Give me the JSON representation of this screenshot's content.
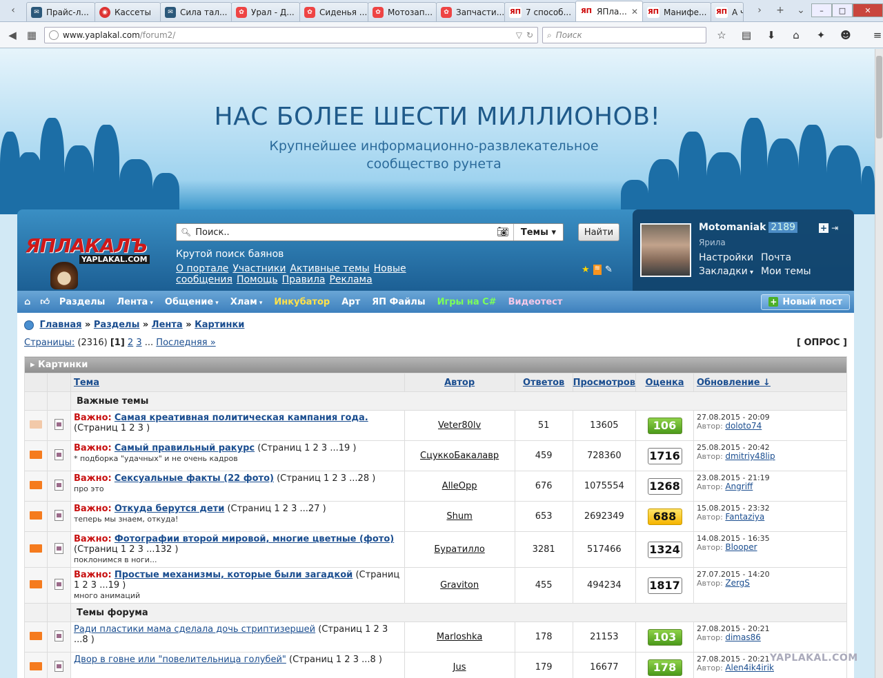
{
  "browser": {
    "tabs": [
      {
        "label": "Прайс-л...",
        "icon": "vk"
      },
      {
        "label": "Кассеты",
        "icon": "mp"
      },
      {
        "label": "Сила тал...",
        "icon": "vk"
      },
      {
        "label": "Урал - Д...",
        "icon": "mt"
      },
      {
        "label": "Сиденья ...",
        "icon": "mt"
      },
      {
        "label": "Мотозап...",
        "icon": "mt"
      },
      {
        "label": "Запчасти...",
        "icon": "mt"
      },
      {
        "label": "7 способ...",
        "icon": "yp"
      },
      {
        "label": "ЯПла...",
        "icon": "yp",
        "active": true
      },
      {
        "label": "Манифе...",
        "icon": "yp"
      },
      {
        "label": "А ч",
        "icon": "yp"
      }
    ],
    "url_domain": "www.yaplakal.com",
    "url_path": "/forum2/",
    "search_placeholder": "Поиск"
  },
  "banner": {
    "title": "НАС БОЛЕЕ ШЕСТИ МИЛЛИОНОВ!",
    "subtitle_line1": "Крупнейшее информационно-развлекательное",
    "subtitle_line2": "сообщество рунета"
  },
  "header": {
    "logo_text": "ЯПЛАКАЛЪ",
    "logo_sub": "YAPLAKAL.COM",
    "search_value": "Поиск..",
    "search_scope": "Темы",
    "find_button": "Найти",
    "tagline": "Крутой поиск баянов",
    "links": [
      "О портале",
      "Участники",
      "Активные темы",
      "Новые сообщения",
      "Помощь",
      "Правила",
      "Реклама"
    ]
  },
  "user": {
    "name": "Motomaniak",
    "count": "2189",
    "rank": "Ярила",
    "settings": "Настройки",
    "mail": "Почта",
    "bookmarks": "Закладки",
    "my_topics": "Мои темы"
  },
  "menu": {
    "items": [
      "Разделы",
      "Лента",
      "Общение",
      "Хлам",
      "Инкубатор",
      "Арт",
      "ЯП Файлы",
      "Игры на C#",
      "Видеотест"
    ],
    "new_post": "Новый пост"
  },
  "breadcrumb": [
    "Главная",
    "Разделы",
    "Лента",
    "Картинки"
  ],
  "pagination": {
    "label": "Страницы:",
    "total": "(2316)",
    "current": "[1]",
    "p2": "2",
    "p3": "3",
    "dots": "...",
    "last": "Последняя »",
    "poll": "[ ОПРОС ]"
  },
  "table": {
    "caption": "Картинки",
    "columns": [
      "Тема",
      "Автор",
      "Ответов",
      "Просмотров",
      "Оценка",
      "Обновление ↓"
    ],
    "important_header": "Важные темы",
    "forum_header": "Темы форума",
    "important_label": "Важно:",
    "rows": [
      {
        "title": "Самая креативная политическая кампания года.",
        "pages": "(Страниц 1 2 3 )",
        "desc": "",
        "author": "Veter80lv",
        "replies": "51",
        "views": "13605",
        "score": "106",
        "score_style": "g",
        "date": "27.08.2015 - 20:09",
        "last": "doloto74",
        "env": "pale"
      },
      {
        "title": "Самый правильный ракурс",
        "pages": "(Страниц 1 2 3 ...19 )",
        "desc": "* подборка \"удачных\" и не очень кадров",
        "author": "СцуккоБакалавр",
        "replies": "459",
        "views": "728360",
        "score": "1716",
        "score_style": "w",
        "date": "25.08.2015 - 20:42",
        "last": "dmitriy48lip",
        "env": "o"
      },
      {
        "title": "Сексуальные факты (22 фото)",
        "pages": "(Страниц 1 2 3 ...28 )",
        "desc": "про это",
        "author": "AlleOpp",
        "replies": "676",
        "views": "1075554",
        "score": "1268",
        "score_style": "w",
        "date": "23.08.2015 - 21:19",
        "last": "Angriff",
        "env": "o"
      },
      {
        "title": "Откуда берутся дети",
        "pages": "(Страниц 1 2 3 ...27 )",
        "desc": "теперь мы знаем, откуда!",
        "author": "Shum",
        "replies": "653",
        "views": "2692349",
        "score": "688",
        "score_style": "y",
        "date": "15.08.2015 - 23:32",
        "last": "Fantaziya",
        "env": "o"
      },
      {
        "title": "Фотографии второй мировой, многие цветные (фото)",
        "pages": "(Страниц 1 2 3 ...132 )",
        "desc": "поклонимся в ноги...",
        "author": "Буратилло",
        "replies": "3281",
        "views": "517466",
        "score": "1324",
        "score_style": "w",
        "date": "14.08.2015 - 16:35",
        "last": "Blooper",
        "env": "o"
      },
      {
        "title": "Простые механизмы, которые были загадкой",
        "pages": "(Страниц 1 2 3 ...19 )",
        "desc": "много анимаций",
        "author": "Graviton",
        "replies": "455",
        "views": "494234",
        "score": "1817",
        "score_style": "w",
        "date": "27.07.2015 - 14:20",
        "last": "ZergS",
        "env": "o"
      }
    ],
    "forum_rows": [
      {
        "title": "Ради пластики мама сделала дочь стриптизершей",
        "pages": "(Страниц 1 2 3 ...8 )",
        "author": "Marloshka",
        "replies": "178",
        "views": "21153",
        "score": "103",
        "score_style": "g",
        "date": "27.08.2015 - 20:21",
        "last": "dimas86"
      },
      {
        "title": "Двор в говне или \"повелительница голубей\"",
        "pages": "(Страниц 1 2 3 ...8 )",
        "author": "Jus",
        "replies": "179",
        "views": "16677",
        "score": "178",
        "score_style": "g",
        "date": "27.08.2015 - 20:21",
        "last": "Alen4ik4irik"
      }
    ],
    "author_label": "Автор:"
  },
  "watermark": "YAPLAKAL.COM"
}
